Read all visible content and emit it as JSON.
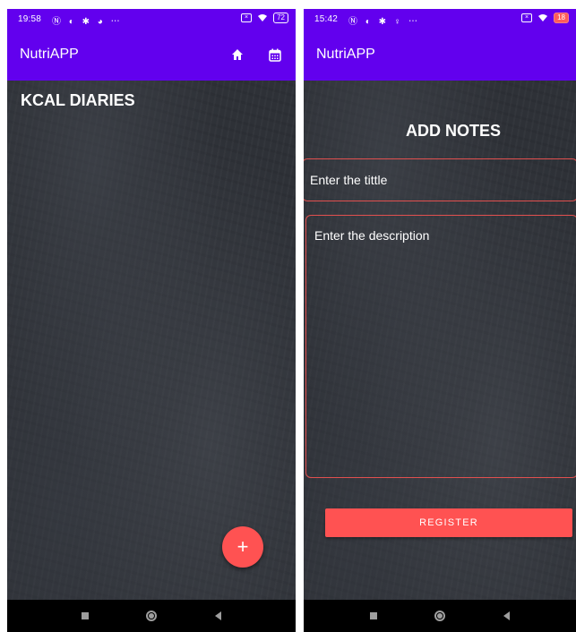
{
  "left": {
    "status": {
      "time": "19:58",
      "icons": "Ⓝ ◐ ✱ ◕ ⋯",
      "battery": "72"
    },
    "app_title": "NutriAPP",
    "heading": "KCAL DIARIES",
    "fab_label": "+",
    "actions": [
      "home-icon",
      "calendar-icon"
    ]
  },
  "right": {
    "status": {
      "time": "15:42",
      "icons": "Ⓝ ◐ ✱ ♀ ⋯",
      "battery": "18"
    },
    "app_title": "NutriAPP",
    "heading": "ADD NOTES",
    "title_placeholder": "Enter the tittle",
    "description_placeholder": "Enter the description",
    "register_label": "REGISTER"
  },
  "colors": {
    "primary": "#6200ee",
    "accent": "#ff5252",
    "field_border": "#e2504f",
    "background": "#2e3137"
  }
}
